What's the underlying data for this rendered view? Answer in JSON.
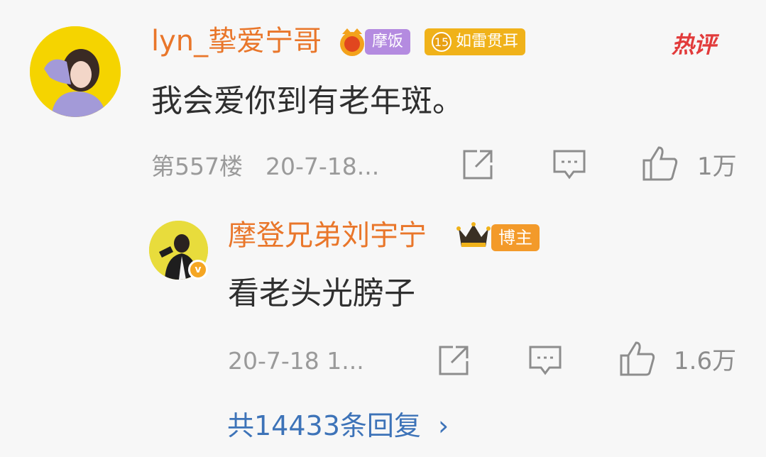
{
  "comment": {
    "username": "lyn_挚爱宁哥",
    "badge_member": "摩饭",
    "badge_level_number": "15",
    "badge_level_label": "如雷贯耳",
    "hot_tag": "热评",
    "content": "我会爱你到有老年斑。",
    "floor": "第557楼",
    "timestamp": "20-7-18...",
    "like_count": "1万"
  },
  "reply": {
    "username": "摩登兄弟刘宇宁",
    "badge_role": "博主",
    "verified_mark": "v",
    "content": "看老头光膀子",
    "timestamp": "20-7-18 1...",
    "like_count": "1.6万"
  },
  "footer": {
    "more_replies": "共14433条回复",
    "more_replies_chevron": "›"
  },
  "icons": {
    "share": "share-icon",
    "comment": "comment-icon",
    "like": "thumbs-up-icon",
    "crown": "crown-icon"
  },
  "colors": {
    "username": "#e9762a",
    "link": "#3d73b8",
    "hot": "#e23b3b",
    "background": "#f7f7f7"
  }
}
